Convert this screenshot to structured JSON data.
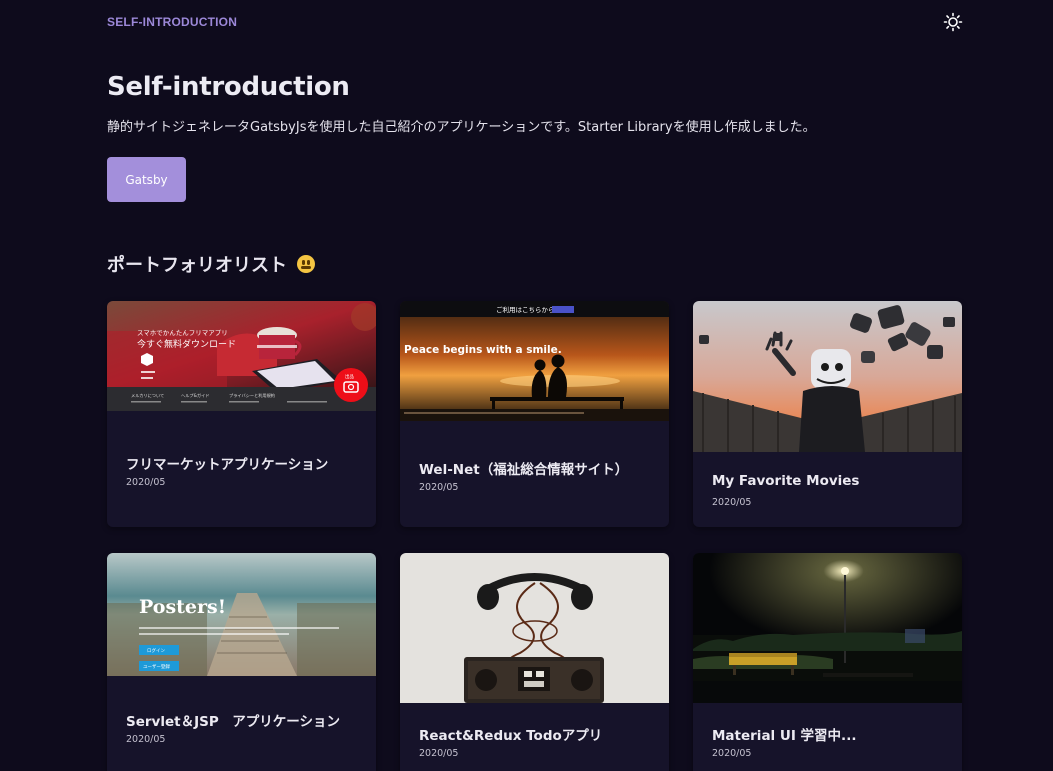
{
  "header": {
    "brand": "SELF-INTRODUCTION",
    "theme_icon": "sun-icon"
  },
  "hero": {
    "title": "Self-introduction",
    "description": "静的サイトジェネレータGatsbyJsを使用した自己紹介のアプリケーションです。Starter Libraryを使用し作成しました。",
    "button_label": "Gatsby"
  },
  "portfolio": {
    "title": "ポートフォリオリスト",
    "emoji": "grimacing-face-emoji",
    "cards": [
      {
        "title": "フリマーケットアプリケーション",
        "date": "2020/05"
      },
      {
        "title": "Wel-Net（福祉総合情報サイト）",
        "date": "2020/05"
      },
      {
        "title": "My Favorite Movies",
        "date": "2020/05"
      },
      {
        "title": "Servlet＆JSP　アプリケーション",
        "date": "2020/05"
      },
      {
        "title": "React&Redux Todoアプリ",
        "date": "2020/05"
      },
      {
        "title": "Material UI 学習中...",
        "date": "2020/05"
      }
    ]
  },
  "thumbnails": {
    "flea_market": {
      "headline_line1": "スマホでかんたんフリマアプリ",
      "headline_line2": "今すぐ無料ダウンロード",
      "footer_items": [
        "メルカリについて",
        "ヘルプ&ガイド",
        "プライバシーと利用規約"
      ],
      "cta_label": "出品"
    },
    "welnet": {
      "top_text": "ご利用はこちらから",
      "overlay": "Peace begins with a smile."
    },
    "posters": {
      "title": "Posters!",
      "button1": "ログイン",
      "button2": "ユーザー登録"
    }
  },
  "colors": {
    "background": "#0e0b1c",
    "card": "#16132a",
    "accent": "#a38fdb",
    "brand": "#9c88d8"
  }
}
